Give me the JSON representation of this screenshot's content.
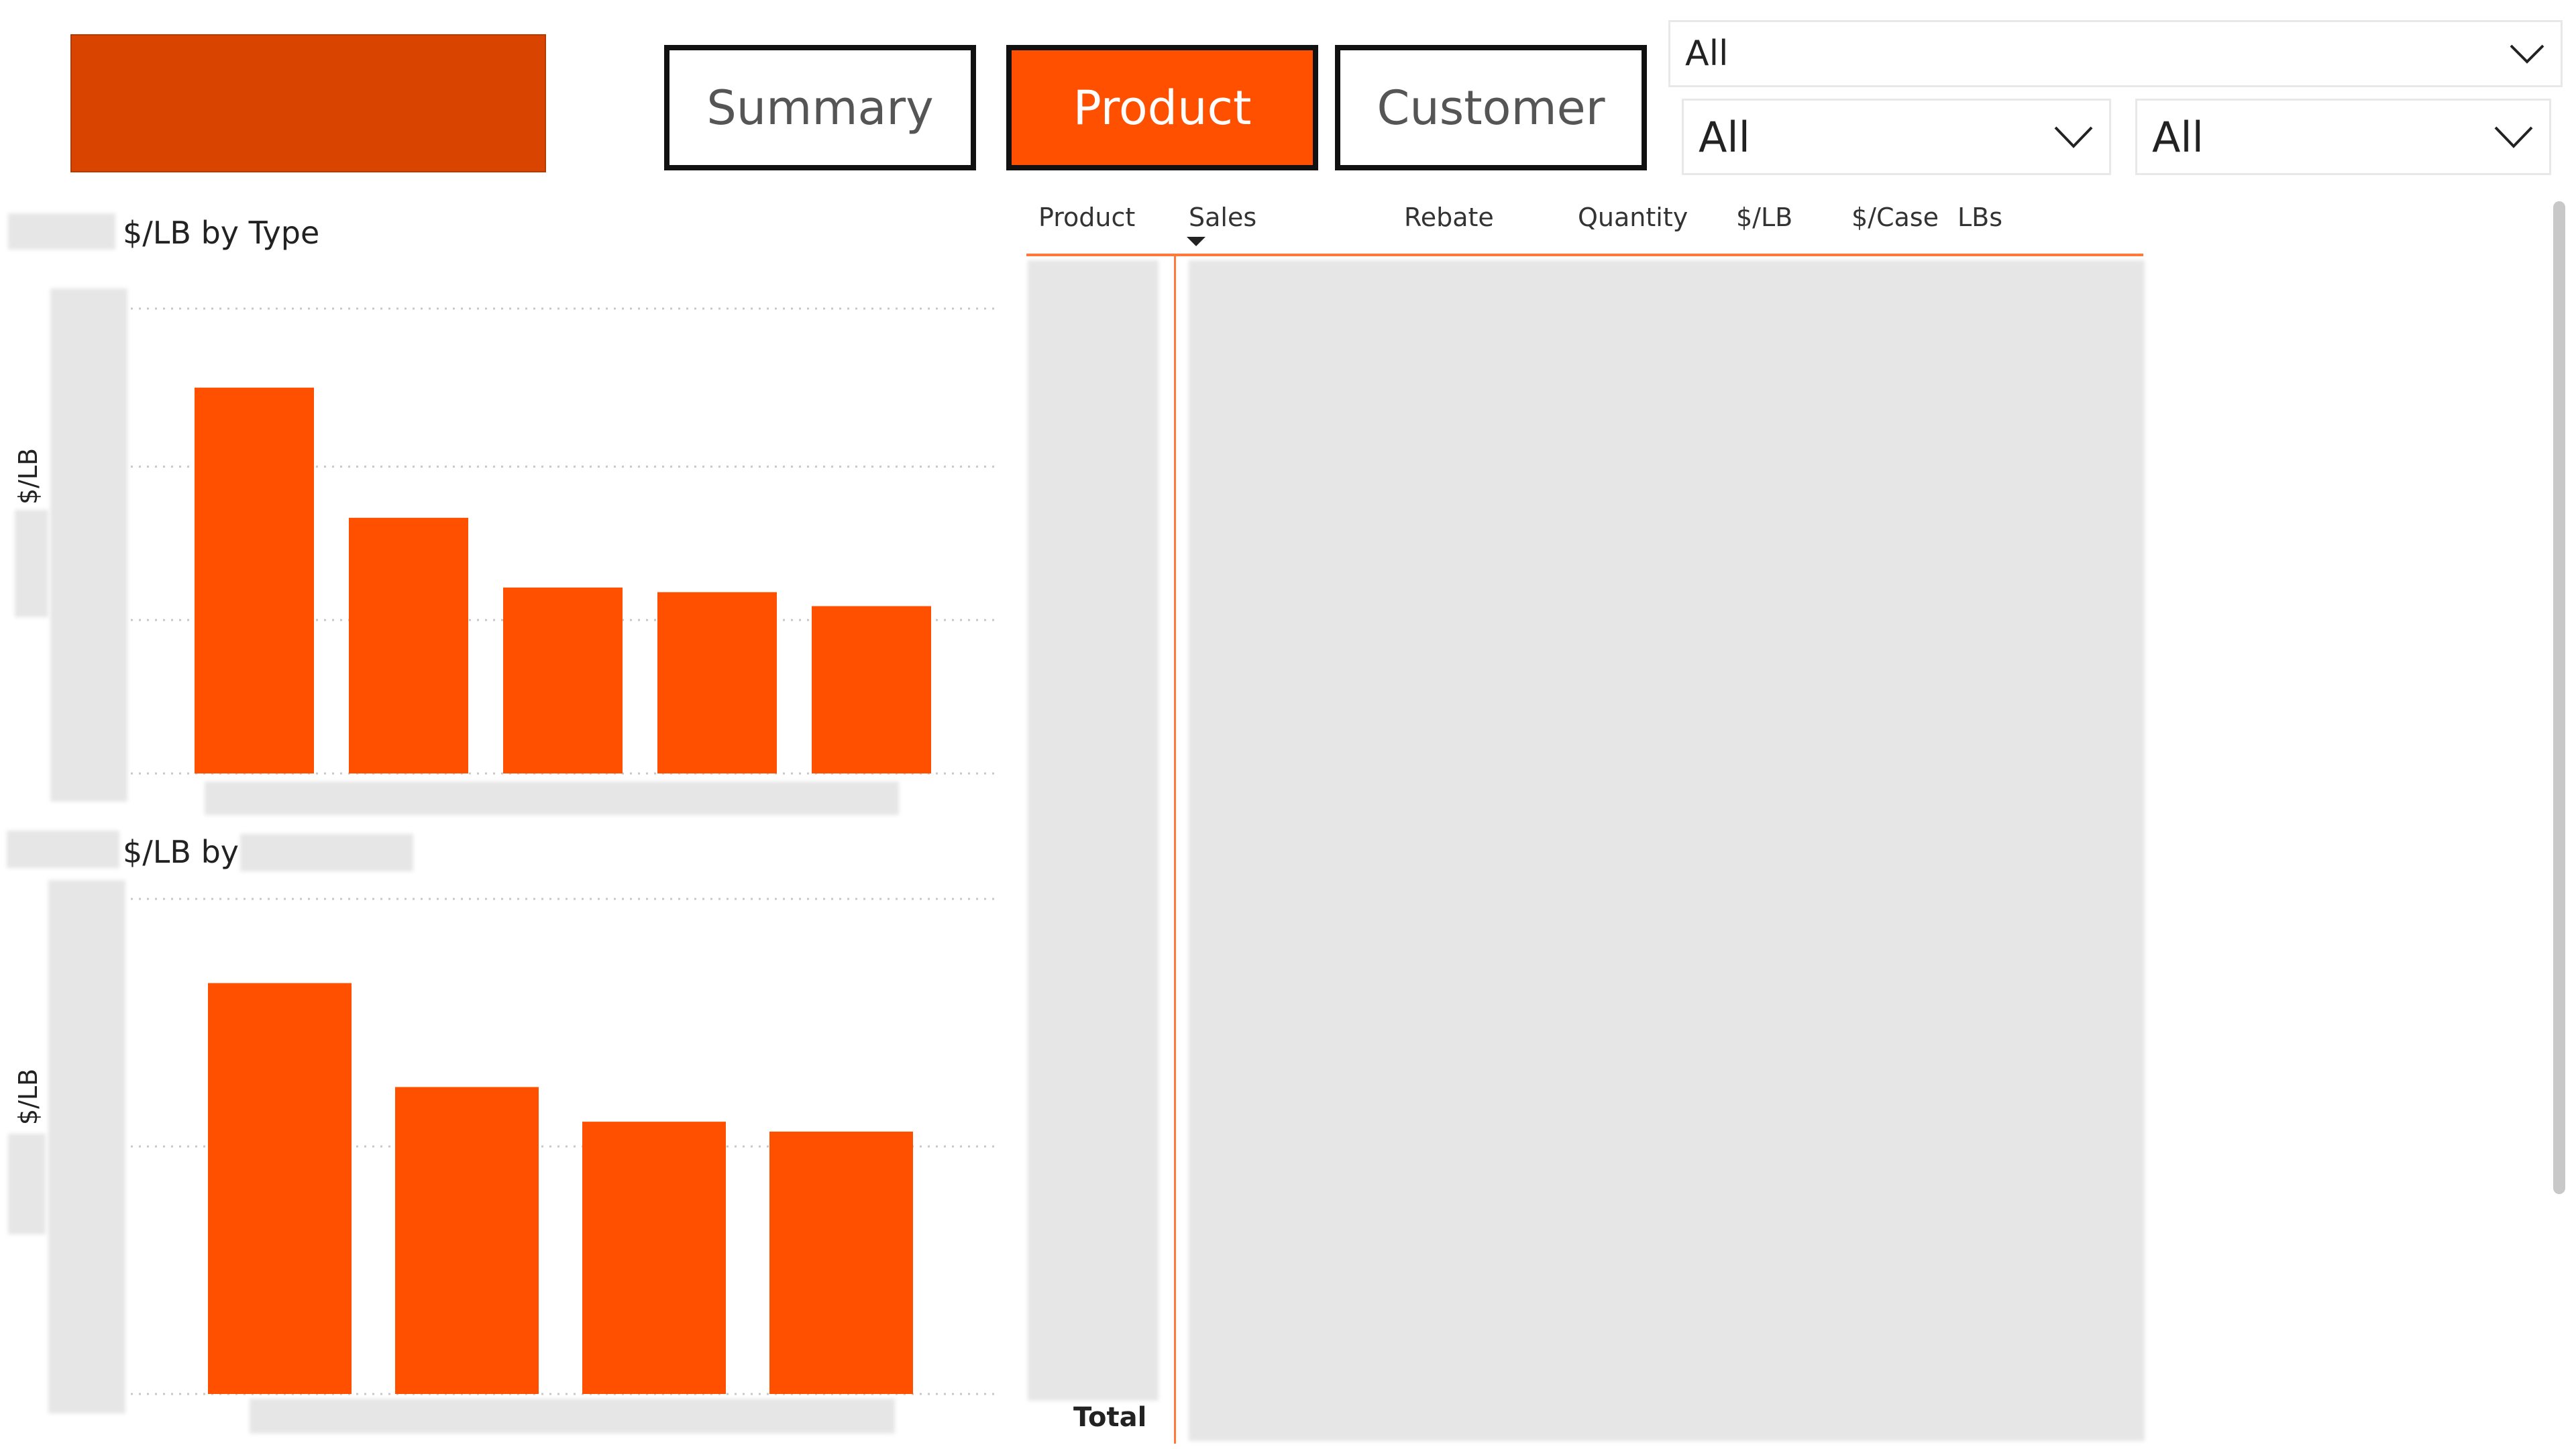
{
  "nav": {
    "summary_label": "Summary",
    "product_label": "Product",
    "customer_label": "Customer",
    "active": "Product"
  },
  "slicers": [
    {
      "value": "All"
    },
    {
      "value": "All"
    },
    {
      "value": "All"
    }
  ],
  "table": {
    "columns": [
      "Product",
      "Sales",
      "Rebate",
      "Quantity",
      "$/LB",
      "$/Case",
      "LBs"
    ],
    "sorted_column": "Sales",
    "total_label": "Total"
  },
  "chart_data": [
    {
      "type": "bar",
      "title": "$/LB by Type",
      "ylabel": "$/LB",
      "categories": [
        "",
        "",
        "",
        "",
        ""
      ],
      "values": [
        0.83,
        0.55,
        0.4,
        0.39,
        0.36
      ],
      "ylim": [
        0,
        1.0
      ],
      "grid": true,
      "color": "#ff5000"
    },
    {
      "type": "bar",
      "title": "$/LB by",
      "ylabel": "$/LB",
      "categories": [
        "",
        "",
        "",
        ""
      ],
      "values": [
        0.83,
        0.62,
        0.55,
        0.53
      ],
      "ylim": [
        0,
        1.0
      ],
      "grid": true,
      "color": "#ff5000"
    }
  ],
  "colors": {
    "accent": "#ff5000",
    "logo": "#d94400",
    "table_line": "#ff7a3a"
  }
}
